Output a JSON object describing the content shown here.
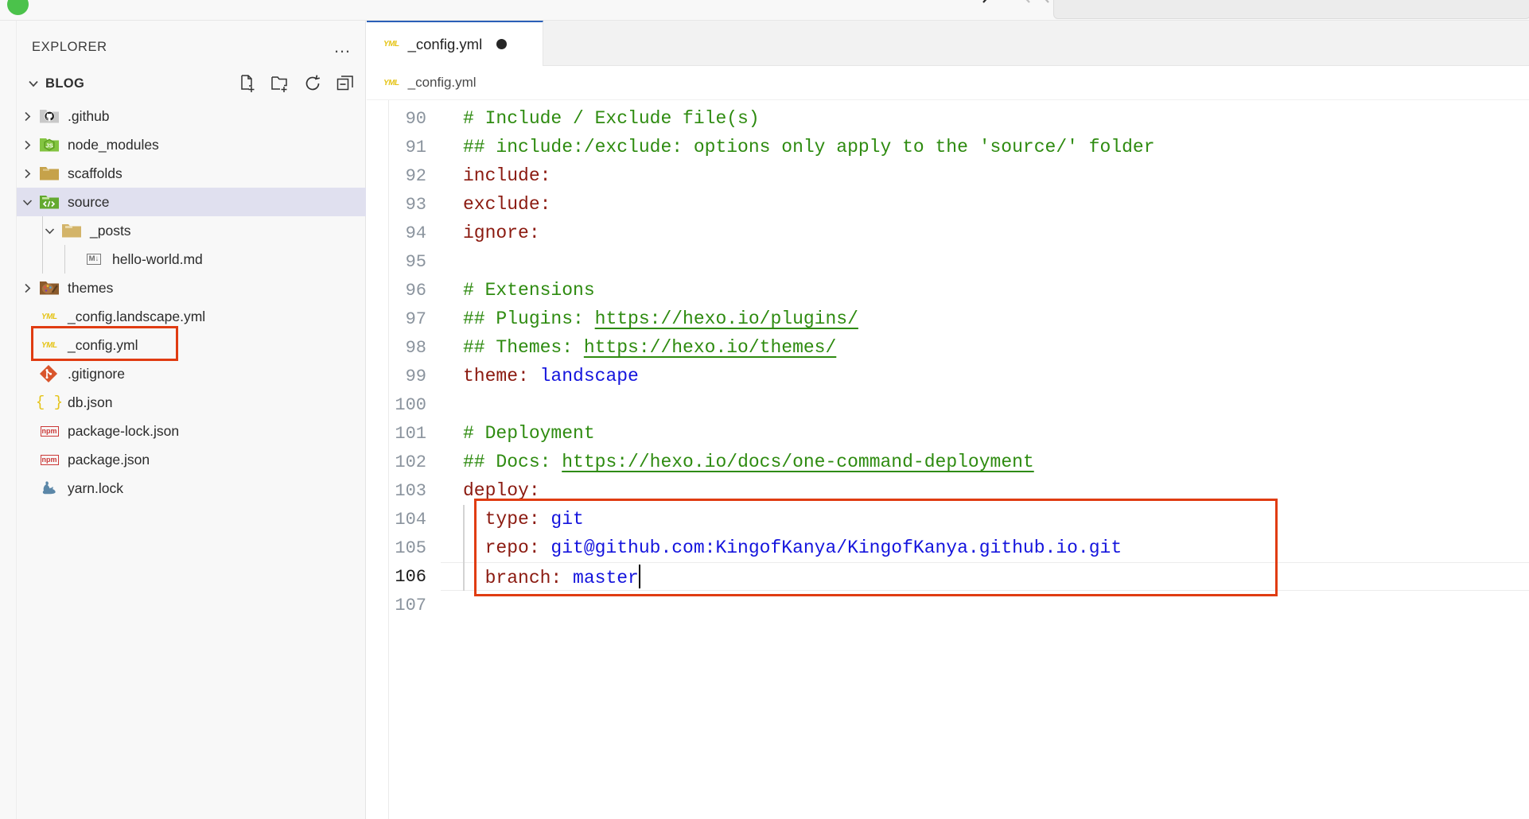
{
  "window": {
    "traffic_light": "green"
  },
  "sidebar": {
    "title": "EXPLORER",
    "more_label": "…",
    "root_folder": "BLOG",
    "actions": [
      {
        "name": "new-file",
        "tooltip": "New File"
      },
      {
        "name": "new-folder",
        "tooltip": "New Folder"
      },
      {
        "name": "refresh",
        "tooltip": "Refresh Explorer"
      },
      {
        "name": "collapse-all",
        "tooltip": "Collapse Folders in Explorer"
      }
    ],
    "items": [
      {
        "label": ".github",
        "icon": "github-folder-icon",
        "type": "folder",
        "depth": 1,
        "expanded": false,
        "selected": false
      },
      {
        "label": "node_modules",
        "icon": "node-folder-icon",
        "type": "folder",
        "depth": 1,
        "expanded": false,
        "selected": false
      },
      {
        "label": "scaffolds",
        "icon": "folder-icon",
        "type": "folder",
        "depth": 1,
        "expanded": false,
        "selected": false
      },
      {
        "label": "source",
        "icon": "source-folder-icon",
        "type": "folder",
        "depth": 1,
        "expanded": true,
        "selected": true
      },
      {
        "label": "_posts",
        "icon": "folder-open-icon",
        "type": "folder",
        "depth": 2,
        "expanded": true,
        "selected": false
      },
      {
        "label": "hello-world.md",
        "icon": "markdown-icon",
        "type": "file",
        "depth": 3,
        "selected": false
      },
      {
        "label": "themes",
        "icon": "themes-folder-icon",
        "type": "folder",
        "depth": 1,
        "expanded": false,
        "selected": false
      },
      {
        "label": "_config.landscape.yml",
        "icon": "yaml-icon",
        "type": "file",
        "depth": 1,
        "selected": false
      },
      {
        "label": "_config.yml",
        "icon": "yaml-icon",
        "type": "file",
        "depth": 1,
        "selected": false,
        "highlighted": true
      },
      {
        "label": ".gitignore",
        "icon": "git-icon",
        "type": "file",
        "depth": 1,
        "selected": false
      },
      {
        "label": "db.json",
        "icon": "json-icon",
        "type": "file",
        "depth": 1,
        "selected": false
      },
      {
        "label": "package-lock.json",
        "icon": "npm-icon",
        "type": "file",
        "depth": 1,
        "selected": false
      },
      {
        "label": "package.json",
        "icon": "npm-icon",
        "type": "file",
        "depth": 1,
        "selected": false
      },
      {
        "label": "yarn.lock",
        "icon": "yarn-icon",
        "type": "file",
        "depth": 1,
        "selected": false
      }
    ]
  },
  "editor": {
    "tab": {
      "label": "_config.yml",
      "icon": "yaml-icon",
      "dirty": true
    },
    "breadcrumb": {
      "label": "_config.yml",
      "icon": "yaml-icon"
    },
    "active_line": 106,
    "cursor_after": "master",
    "lines": [
      {
        "n": 90,
        "segments": [
          {
            "t": "# Include / Exclude file(s)",
            "c": "cm"
          }
        ]
      },
      {
        "n": 91,
        "segments": [
          {
            "t": "## include:/exclude: options only apply to the 'source/' folder",
            "c": "cm"
          }
        ]
      },
      {
        "n": 92,
        "segments": [
          {
            "t": "include:",
            "c": "key"
          }
        ]
      },
      {
        "n": 93,
        "segments": [
          {
            "t": "exclude:",
            "c": "key"
          }
        ]
      },
      {
        "n": 94,
        "segments": [
          {
            "t": "ignore:",
            "c": "key"
          }
        ]
      },
      {
        "n": 95,
        "segments": []
      },
      {
        "n": 96,
        "segments": [
          {
            "t": "# Extensions",
            "c": "cm"
          }
        ]
      },
      {
        "n": 97,
        "segments": [
          {
            "t": "## Plugins: ",
            "c": "cm"
          },
          {
            "t": "https://hexo.io/plugins/",
            "c": "lnk"
          }
        ]
      },
      {
        "n": 98,
        "segments": [
          {
            "t": "## Themes: ",
            "c": "cm"
          },
          {
            "t": "https://hexo.io/themes/",
            "c": "lnk"
          }
        ]
      },
      {
        "n": 99,
        "segments": [
          {
            "t": "theme: ",
            "c": "key"
          },
          {
            "t": "landscape",
            "c": "val"
          }
        ]
      },
      {
        "n": 100,
        "segments": []
      },
      {
        "n": 101,
        "segments": [
          {
            "t": "# Deployment",
            "c": "cm"
          }
        ]
      },
      {
        "n": 102,
        "segments": [
          {
            "t": "## Docs: ",
            "c": "cm"
          },
          {
            "t": "https://hexo.io/docs/one-command-deployment",
            "c": "lnk"
          }
        ]
      },
      {
        "n": 103,
        "segments": [
          {
            "t": "deploy:",
            "c": "key"
          }
        ]
      },
      {
        "n": 104,
        "segments": [
          {
            "t": "  type: ",
            "c": "key"
          },
          {
            "t": "git",
            "c": "val"
          }
        ],
        "indent": true
      },
      {
        "n": 105,
        "segments": [
          {
            "t": "  repo: ",
            "c": "key"
          },
          {
            "t": "git@github.com:KingofKanya/KingofKanya.github.io.git",
            "c": "val"
          }
        ],
        "indent": true
      },
      {
        "n": 106,
        "segments": [
          {
            "t": "  branch: ",
            "c": "key"
          },
          {
            "t": "master",
            "c": "val"
          }
        ],
        "indent": true,
        "active": true
      },
      {
        "n": 107,
        "segments": []
      }
    ]
  },
  "annotations": [
    {
      "name": "explorer-config-yml-highlight",
      "color": "#e03c12"
    },
    {
      "name": "deploy-block-highlight",
      "color": "#e03c12"
    }
  ]
}
